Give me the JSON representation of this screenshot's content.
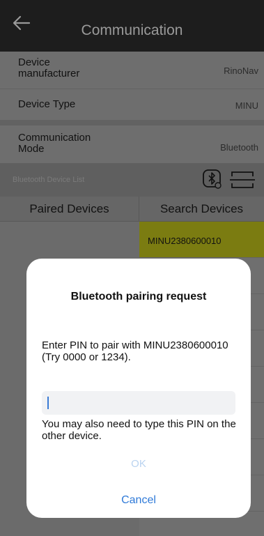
{
  "header": {
    "title": "Communication",
    "back_icon": "arrow-left-icon"
  },
  "settings": {
    "manufacturer": {
      "label": "Device manufacturer",
      "value": "RinoNav"
    },
    "type": {
      "label": "Device Type",
      "value": "MINU"
    },
    "mode": {
      "label": "Communication Mode",
      "value": "Bluetooth"
    }
  },
  "device_list": {
    "label": "Bluetooth Device List",
    "icons": [
      "bluetooth-settings-icon",
      "scan-icon"
    ]
  },
  "tabs": {
    "paired": "Paired Devices",
    "search": "Search Devices"
  },
  "search_results": [
    {
      "name": "MINU2380600010",
      "selected": true
    }
  ],
  "dialog": {
    "title": "Bluetooth pairing request",
    "message": "Enter PIN to pair with MINU2380600010 (Try 0000 or 1234).",
    "pin_value": "",
    "hint": "You may also need to type this PIN on the other device.",
    "ok_label": "OK",
    "cancel_label": "Cancel"
  },
  "colors": {
    "header_bg": "#1d1d1d",
    "selected_row": "#7b7c11",
    "accent_blue": "#2f7ad8",
    "ok_disabled": "#b9d3f0"
  }
}
